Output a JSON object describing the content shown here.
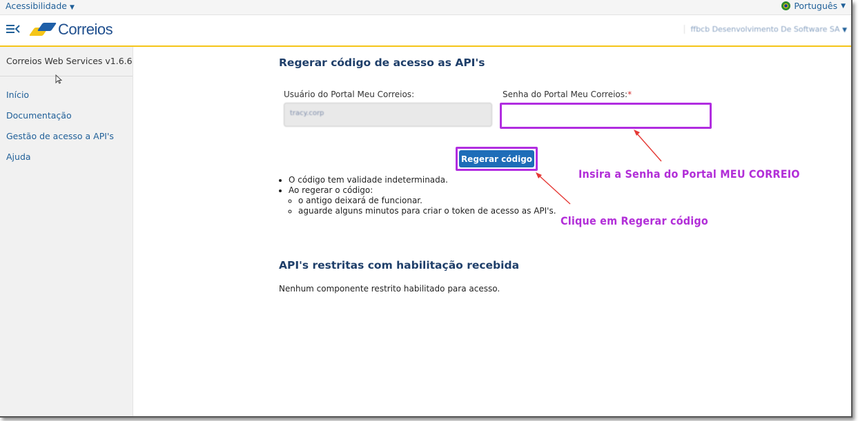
{
  "topbar": {
    "accessibility_label": "Acessibilidade",
    "language_label": "Português"
  },
  "header": {
    "logo_text": "Correios",
    "company_name": "ffbcb Desenvolvimento De Software SA"
  },
  "sidebar": {
    "version": "Correios Web Services v1.6.6",
    "items": [
      {
        "label": "Início"
      },
      {
        "label": "Documentação"
      },
      {
        "label": "Gestão de acesso a API's"
      },
      {
        "label": "Ajuda"
      }
    ]
  },
  "main": {
    "title": "Regerar código de acesso as API's",
    "user_label": "Usuário do Portal Meu Correios:",
    "user_value": "tracy.corp",
    "password_label": "Senha do Portal Meu Correios:",
    "required_mark": "*",
    "button_label": "Regerar código",
    "notes": {
      "item1": "O código tem validade indeterminada.",
      "item2": "Ao regerar o código:",
      "sub1": "o antigo deixará de funcionar.",
      "sub2": "aguarde alguns minutos para criar o token de acesso as API's."
    },
    "restricted_title": "API's restritas com habilitação recebida",
    "restricted_text": "Nenhum componente restrito habilitado para acesso."
  },
  "annotations": {
    "password_hint": "Insira a Senha do Portal MEU CORREIO",
    "button_hint": "Clique em Regerar código"
  },
  "colors": {
    "primary_blue": "#1e6db8",
    "highlight_purple": "#b12de0",
    "header_accent": "#f5c518"
  }
}
